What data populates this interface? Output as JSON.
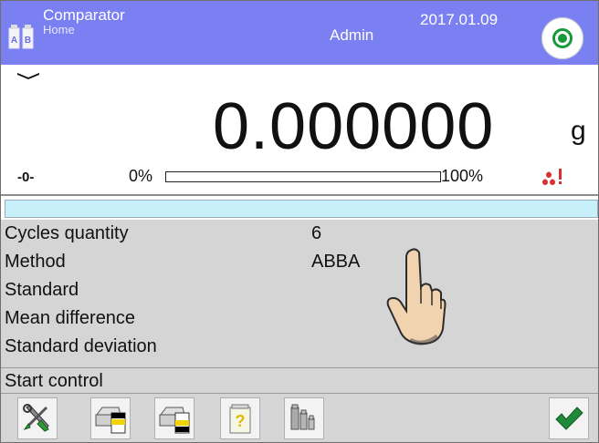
{
  "header": {
    "app_title": "Comparator",
    "subtitle": "Home",
    "user": "Admin",
    "date": "2017.01.09",
    "logo_icon": "ab-comparator-icon",
    "status_icon": "record-icon",
    "colors": {
      "header_bg": "#7a7ff2",
      "status_green": "#159a3a"
    }
  },
  "display": {
    "weight": "0.000000",
    "unit": "g",
    "zero_indicator": "-0-",
    "range_min_label": "0%",
    "range_max_label": "100%",
    "load_fraction": 0.0,
    "warning_icon": "drops-warning-icon"
  },
  "params": [
    {
      "label": "Cycles quantity",
      "value": "6"
    },
    {
      "label": "Method",
      "value": "ABBA"
    },
    {
      "label": "Standard",
      "value": ""
    },
    {
      "label": "Mean difference",
      "value": ""
    },
    {
      "label": "Standard deviation",
      "value": ""
    }
  ],
  "start_control_label": "Start control",
  "toolbar": {
    "buttons": [
      "settings-tools-icon",
      "print-header-icon",
      "print-footer-icon",
      "report-help-icon",
      "weights-icon",
      "confirm-check-icon"
    ]
  },
  "colors": {
    "panel_bg": "#d5d5d5",
    "info_bar": "#c8f0fb",
    "check_green": "#1f8a3a"
  }
}
